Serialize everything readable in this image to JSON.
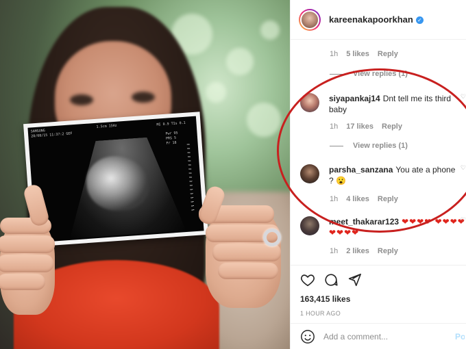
{
  "post": {
    "username": "kareenakapoorkhan",
    "likes": "163,415 likes",
    "time_ago": "1 HOUR AGO",
    "add_comment_placeholder": "Add a comment...",
    "post_button": "Post"
  },
  "top_meta": {
    "time": "1h",
    "likes": "5 likes",
    "reply": "Reply",
    "view_replies": "View replies (1)"
  },
  "comments": [
    {
      "user": "siyapankaj14",
      "text": "Dnt tell me its third baby",
      "time": "1h",
      "likes": "17 likes",
      "reply": "Reply",
      "view_replies": "View replies (1)"
    },
    {
      "user": "parsha_sanzana",
      "text": "You ate a phone ? 😮",
      "time": "1h",
      "likes": "4 likes",
      "reply": "Reply"
    },
    {
      "user": "meet_thakarar123",
      "text": "❤❤❤❤ ❤❤❤❤❤❤❤❤",
      "time": "1h",
      "likes": "2 likes",
      "reply": "Reply"
    }
  ],
  "scan": {
    "line1": "SAMSUNG",
    "line2": "28/08/15 11:37:2 GEF",
    "line3": "1.5cm 15Hz",
    "right1": "MI 0.9 TIs 0.1",
    "right2": "Pwr 95",
    "right3": "PRS 5",
    "right4": "Fr 18"
  },
  "icons": [
    "heart-icon",
    "comment-icon",
    "share-icon",
    "emoji-icon",
    "verified-badge-icon"
  ],
  "colors": {
    "verified": "#3897f0",
    "highlight_circle": "#c8201f",
    "hearts": "#e0241c"
  }
}
